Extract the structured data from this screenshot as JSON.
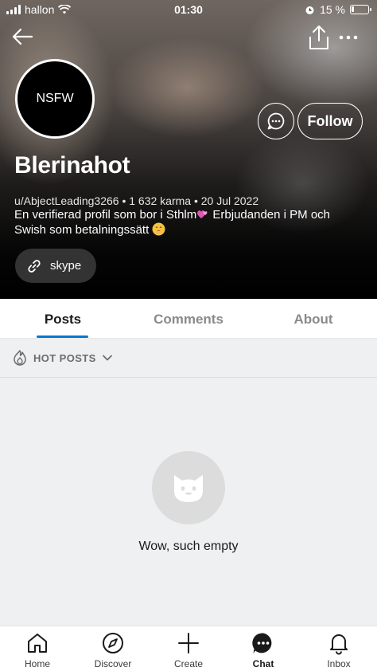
{
  "status_bar": {
    "carrier": "hallon",
    "time": "01:30",
    "battery": "15 %",
    "battery_level": 0.15
  },
  "header": {
    "avatar_text": "NSFW",
    "follow_label": "Follow",
    "display_name": "Blerinahot",
    "meta": "u/AbjectLeading3266 • 1 632 karma • 20 Jul 2022",
    "bio_part1": "En verifierad profil som bor i Sthlm",
    "bio_part2": " Erbjudanden i PM och Swish som betalningssätt ",
    "link_label": "skype",
    "icons": [
      "back-arrow-icon",
      "share-icon",
      "more-icon",
      "chat-bubble-icon",
      "link-icon"
    ]
  },
  "tabs": [
    {
      "label": "Posts",
      "active": true
    },
    {
      "label": "Comments",
      "active": false
    },
    {
      "label": "About",
      "active": false
    }
  ],
  "sort": {
    "label": "HOT POSTS"
  },
  "empty_state": {
    "text": "Wow, such empty"
  },
  "bottom_nav": [
    {
      "label": "Home",
      "icon": "home-icon"
    },
    {
      "label": "Discover",
      "icon": "compass-icon"
    },
    {
      "label": "Create",
      "icon": "plus-icon"
    },
    {
      "label": "Chat",
      "icon": "chat-icon"
    },
    {
      "label": "Inbox",
      "icon": "bell-icon"
    }
  ],
  "colors": {
    "accent": "#0079d3",
    "content_bg": "#eef0f2"
  }
}
